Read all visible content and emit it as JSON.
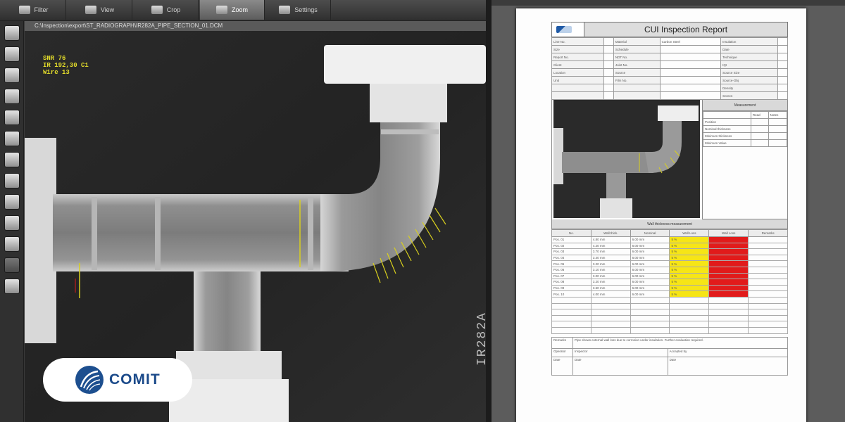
{
  "top_tabs": [
    {
      "label": "Filter",
      "active": false
    },
    {
      "label": "View",
      "active": false
    },
    {
      "label": "Crop",
      "active": false
    },
    {
      "label": "Zoom",
      "active": true
    },
    {
      "label": "Settings",
      "active": false
    }
  ],
  "viewer": {
    "path": "C:\\Inspection\\export\\ST_RADIOGRAPH\\IR282A_PIPE_SECTION_01.DCM",
    "scan_info": [
      "SNR 76",
      "IR 192,30 Ci",
      "Wire 13"
    ],
    "film_id": "IR282A"
  },
  "report": {
    "title": "CUI Inspection Report",
    "info_rows": [
      [
        "Line No.",
        "",
        "Material",
        "Carbon Steel",
        "Insulation",
        ""
      ],
      [
        "Size",
        "",
        "Schedule",
        "",
        "Date",
        ""
      ],
      [
        "Report No.",
        "",
        "NDT No.",
        "",
        "Technique",
        ""
      ],
      [
        "Client",
        "",
        "Joint No.",
        "",
        "IQI",
        ""
      ],
      [
        "Location",
        "",
        "Source",
        "",
        "Source Size",
        ""
      ],
      [
        "Unit",
        "",
        "Film No.",
        "",
        "Source-Obj",
        ""
      ],
      [
        "",
        "",
        "",
        "",
        "Density",
        ""
      ],
      [
        "",
        "",
        "",
        "",
        "Screen",
        ""
      ]
    ],
    "measurement": {
      "header": "Measurement",
      "columns": [
        "",
        "Read",
        "Notes"
      ],
      "rows": [
        [
          "Position",
          "",
          ""
        ],
        [
          "Nominal thickness",
          "",
          ""
        ],
        [
          "Minimum thickness",
          "",
          ""
        ],
        [
          "Minimum Value",
          "",
          ""
        ]
      ]
    },
    "wall_table": {
      "header": "Wall thickness measurement",
      "columns": [
        "No.",
        "Wall thick.",
        "Nominal",
        "Wall Loss",
        "Wall Loss",
        "Remarks"
      ],
      "rows": [
        [
          "Pos. 01",
          "4.80 mm",
          "6.00 mm",
          "5 %",
          "",
          ""
        ],
        [
          "Pos. 02",
          "4.20 mm",
          "6.00 mm",
          "5 %",
          "",
          ""
        ],
        [
          "Pos. 03",
          "3.70 mm",
          "6.00 mm",
          "5 %",
          "",
          ""
        ],
        [
          "Pos. 04",
          "3.40 mm",
          "6.00 mm",
          "5 %",
          "",
          ""
        ],
        [
          "Pos. 05",
          "3.20 mm",
          "6.00 mm",
          "5 %",
          "",
          ""
        ],
        [
          "Pos. 06",
          "3.10 mm",
          "6.00 mm",
          "5 %",
          "",
          ""
        ],
        [
          "Pos. 07",
          "3.00 mm",
          "6.00 mm",
          "5 %",
          "",
          ""
        ],
        [
          "Pos. 08",
          "3.20 mm",
          "6.00 mm",
          "5 %",
          "",
          ""
        ],
        [
          "Pos. 09",
          "3.50 mm",
          "6.00 mm",
          "5 %",
          "",
          ""
        ],
        [
          "Pos. 10",
          "4.00 mm",
          "6.00 mm",
          "5 %",
          "",
          ""
        ]
      ],
      "row_colors": [
        [
          "y",
          "r"
        ],
        [
          "y",
          "r"
        ],
        [
          "y",
          "r"
        ],
        [
          "y",
          "r"
        ],
        [
          "y",
          "r"
        ],
        [
          "y",
          "r"
        ],
        [
          "y",
          "r"
        ],
        [
          "y",
          "r"
        ],
        [
          "y",
          "r"
        ],
        [
          "y",
          "r"
        ]
      ],
      "empty_rows": 6
    },
    "remarks_label": "Remarks",
    "remarks_text": "Pipe shows external wall loss due to corrosion under insulation. Further evaluation required.",
    "footer": [
      [
        "Operator",
        "Inspector",
        "Accepted by"
      ],
      [
        "Date",
        "Date",
        "Date"
      ]
    ]
  },
  "badge": {
    "text": "COMIT"
  },
  "colors": {
    "accent_yellow": "#f6e516",
    "accent_red": "#e11b1b",
    "brand_blue": "#1d4f8f"
  }
}
